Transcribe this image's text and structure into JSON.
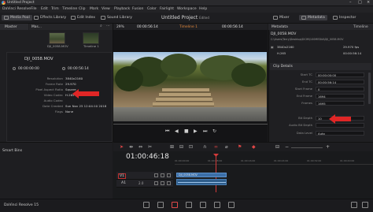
{
  "window": {
    "title": "Untitled Project",
    "menu": [
      "DaVinci Resolve",
      "File",
      "Edit",
      "Trim",
      "Timeline",
      "Clip",
      "Mark",
      "View",
      "Playback",
      "Fusion",
      "Color",
      "Fairlight",
      "Workspace",
      "Help"
    ]
  },
  "toolbar": {
    "media_pool": "Media Pool",
    "effects_library": "Effects Library",
    "edit_index": "Edit Index",
    "sound_library": "Sound Library",
    "project_title": "Untitled Project",
    "project_suffix": "Edited",
    "mixer": "Mixer",
    "metadata": "Metadata",
    "inspector": "Inspector"
  },
  "media_pool": {
    "master_label": "Master",
    "search_label": "Mas...",
    "clips": [
      {
        "label": "DJI_0058.MOV"
      },
      {
        "label": "Timeline 1"
      }
    ],
    "smart_bins_label": "Smart Bins"
  },
  "clip_info": {
    "name": "DJI_0058.MOV",
    "start_tc": "00:00:00:00",
    "end_tc": "00:00:56:14",
    "properties": [
      {
        "key": "Resolution",
        "value": "3840x2160"
      },
      {
        "key": "Frame Rate",
        "value": "29.970"
      },
      {
        "key": "Pixel Aspect Ratio",
        "value": "Square"
      },
      {
        "key": "Video Codec",
        "value": "H.265"
      },
      {
        "key": "Audio Codec",
        "value": ""
      },
      {
        "key": "Date Created",
        "value": "Sun Nov 25 12:04:10 2018"
      },
      {
        "key": "Flags",
        "value": "None"
      }
    ]
  },
  "viewer": {
    "zoom": "29%",
    "timecode": "00:00:56:14",
    "timeline_name": "Timeline 1",
    "frame_tc": "00:00:56:14"
  },
  "metadata_panel": {
    "title": "Metadata",
    "tab": "Timeline",
    "clip_name": "DJI_0058.MOV",
    "path": "C:\\Users\\Terry\\Desktop\\DCIM\\100MEDIA\\DJI_0058.MOV",
    "resolution": "3840x2160",
    "fps": "29.970 fps",
    "codec": "H.265",
    "duration": "00:00:56:14",
    "section": "Clip Details",
    "rows": [
      {
        "key": "Start TC",
        "value": "00:00:00:00"
      },
      {
        "key": "End TC",
        "value": "00:00:56:14"
      },
      {
        "key": "Start Frame",
        "value": "0"
      },
      {
        "key": "End Frame",
        "value": "1694"
      },
      {
        "key": "Frames",
        "value": "1695"
      },
      {
        "key": "Bit Depth",
        "value": "10"
      },
      {
        "key": "Audio Bit Depth",
        "value": ""
      },
      {
        "key": "Data Level",
        "value": "Auto"
      }
    ]
  },
  "timeline": {
    "timecode": "01:00:46:18",
    "ruler": [
      "01:00:00:00",
      "01:00:08:00",
      "01:00:16:00",
      "01:00:24:00",
      "01:00:32:00",
      "01:00:40:00"
    ],
    "tracks": [
      {
        "label": "V1"
      },
      {
        "label": "A1",
        "level": "2.0"
      }
    ],
    "clip_label": "DJI_0058.MOV"
  },
  "status": {
    "app_name": "DaVinci Resolve 15"
  },
  "colors": {
    "background": "#1a1a1c",
    "accent_red": "#e02626",
    "clip_blue": "#3c6fa8"
  }
}
